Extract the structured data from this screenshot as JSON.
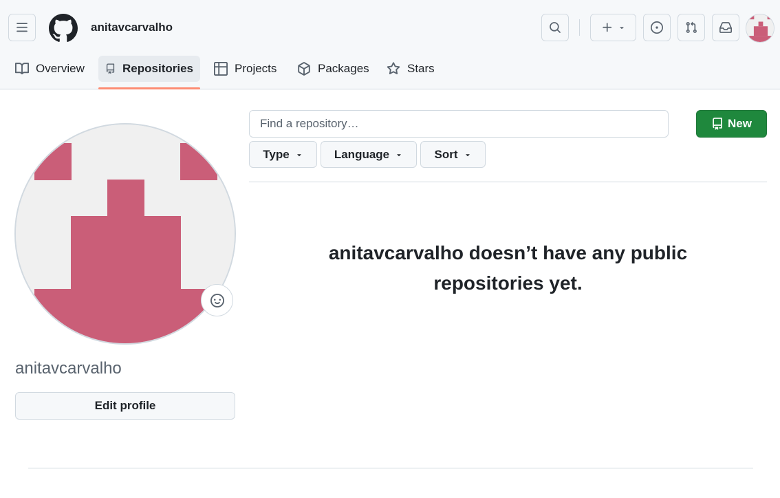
{
  "header": {
    "username": "anitavcarvalho",
    "icons": {
      "menu": "hamburger-icon",
      "logo": "github-logo-icon",
      "search": "search-icon",
      "create": "plus-icon",
      "issues": "issue-opened-icon",
      "pulls": "git-pull-request-icon",
      "inbox": "inbox-icon"
    },
    "avatar_color": "#ca5e78"
  },
  "tabs": [
    {
      "label": "Overview",
      "icon": "book-icon"
    },
    {
      "label": "Repositories",
      "icon": "repo-icon",
      "selected": true
    },
    {
      "label": "Projects",
      "icon": "table-icon"
    },
    {
      "label": "Packages",
      "icon": "package-icon"
    },
    {
      "label": "Stars",
      "icon": "star-icon"
    }
  ],
  "sidebar": {
    "username": "anitavcarvalho",
    "edit_profile_label": "Edit profile",
    "status_icon": "smiley-icon"
  },
  "repos": {
    "search_placeholder": "Find a repository…",
    "new_button_label": "New",
    "filters": [
      {
        "label": "Type"
      },
      {
        "label": "Language"
      },
      {
        "label": "Sort"
      }
    ],
    "empty_message_line1": "anitavcarvalho doesn’t have any public",
    "empty_message_line2": "repositories yet."
  },
  "colors": {
    "accent_green": "#1f883d",
    "selected_tab_underline": "#fd8c73",
    "identicon": "#ca5e78"
  }
}
